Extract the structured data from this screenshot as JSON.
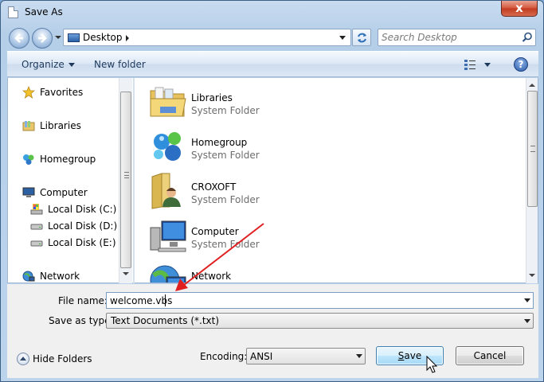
{
  "window": {
    "title": "Save As",
    "close_symbol": "x"
  },
  "address": {
    "location": "Desktop"
  },
  "search": {
    "placeholder": "Search Desktop"
  },
  "command_bar": {
    "organize_label": "Organize",
    "new_folder_label": "New folder",
    "help_symbol": "?"
  },
  "nav": {
    "items": [
      {
        "label": "Favorites",
        "icon": "star-icon"
      },
      {
        "label": "Libraries",
        "icon": "libraries-icon"
      },
      {
        "label": "Homegroup",
        "icon": "homegroup-icon"
      },
      {
        "label": "Computer",
        "icon": "computer-icon"
      },
      {
        "label": "Local Disk (C:)",
        "icon": "drive-c-icon"
      },
      {
        "label": "Local Disk (D:)",
        "icon": "drive-icon"
      },
      {
        "label": "Local Disk (E:)",
        "icon": "drive-icon"
      },
      {
        "label": "Network",
        "icon": "network-icon"
      }
    ]
  },
  "files": [
    {
      "name": "Libraries",
      "type": "System Folder",
      "icon": "libraries-folder-icon"
    },
    {
      "name": "Homegroup",
      "type": "System Folder",
      "icon": "homegroup-icon"
    },
    {
      "name": "CROXOFT",
      "type": "System Folder",
      "icon": "user-folder-icon"
    },
    {
      "name": "Computer",
      "type": "System Folder",
      "icon": "computer-icon"
    },
    {
      "name": "Network",
      "type": "",
      "icon": "network-icon"
    }
  ],
  "form": {
    "file_name_label": "File name:",
    "file_name_value": "welcome.vbs",
    "save_type_label": "Save as type:",
    "save_type_value": "Text Documents (*.txt)",
    "encoding_label": "Encoding:",
    "encoding_value": "ANSI"
  },
  "buttons": {
    "hide_folders": "Hide Folders",
    "save_first": "S",
    "save_rest": "ave",
    "cancel": "Cancel"
  },
  "colors": {
    "accent": "#3c7fb1",
    "annotation_arrow": "#e02020"
  }
}
